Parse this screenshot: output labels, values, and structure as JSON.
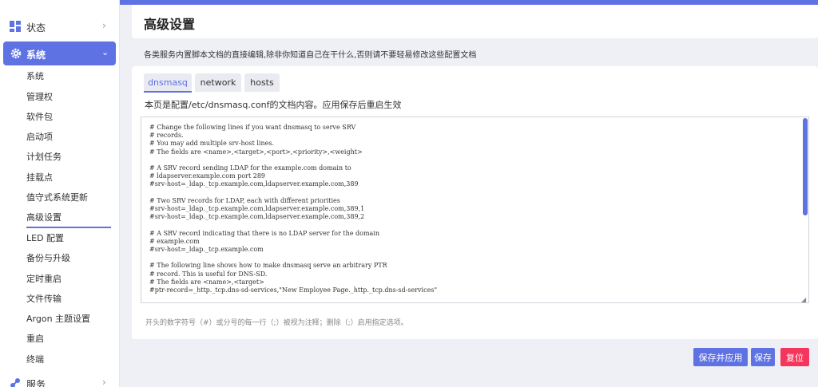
{
  "sidebar": {
    "status_label": "状态",
    "system_label": "系统",
    "services_label": "服务",
    "items": [
      "系统",
      "管理权",
      "软件包",
      "启动项",
      "计划任务",
      "挂载点",
      "值守式系统更新",
      "高级设置",
      "LED 配置",
      "备份与升级",
      "定时重启",
      "文件传输",
      "Argon 主题设置",
      "重启",
      "终端"
    ]
  },
  "main": {
    "title": "高级设置",
    "description": "各类服务内置脚本文档的直接编辑,除非你知道自己在干什么,否则请不要轻易修改这些配置文档",
    "tabs": [
      "dnsmasq",
      "network",
      "hosts"
    ],
    "file_info": "本页是配置/etc/dnsmasq.conf的文档内容。应用保存后重启生效",
    "editor_content": "# Change the following lines if you want dnsmasq to serve SRV\n# records.\n# You may add multiple srv-host lines.\n# The fields are <name>,<target>,<port>,<priority>,<weight>\n\n# A SRV record sending LDAP for the example.com domain to\n# ldapserver.example.com port 289\n#srv-host=_ldap._tcp.example.com,ldapserver.example.com,389\n\n# Two SRV records for LDAP, each with different priorities\n#srv-host=_ldap._tcp.example.com,ldapserver.example.com,389,1\n#srv-host=_ldap._tcp.example.com,ldapserver.example.com,389,2\n\n# A SRV record indicating that there is no LDAP server for the domain\n# example.com\n#srv-host=_ldap._tcp.example.com\n\n# The following line shows how to make dnsmasq serve an arbitrary PTR\n# record. This is useful for DNS-SD.\n# The fields are <name>,<target>\n#ptr-record=_http._tcp.dns-sd-services,\"New Employee Page._http._tcp.dns-sd-services\"",
    "hint": "开头的数字符号（#）或分号的每一行（;）被视为注释；删除（;）启用指定选项。"
  },
  "buttons": {
    "save_apply": "保存并应用",
    "save": "保存",
    "reset": "复位"
  },
  "colors": {
    "accent": "#5e72e4",
    "danger": "#f5365c"
  }
}
